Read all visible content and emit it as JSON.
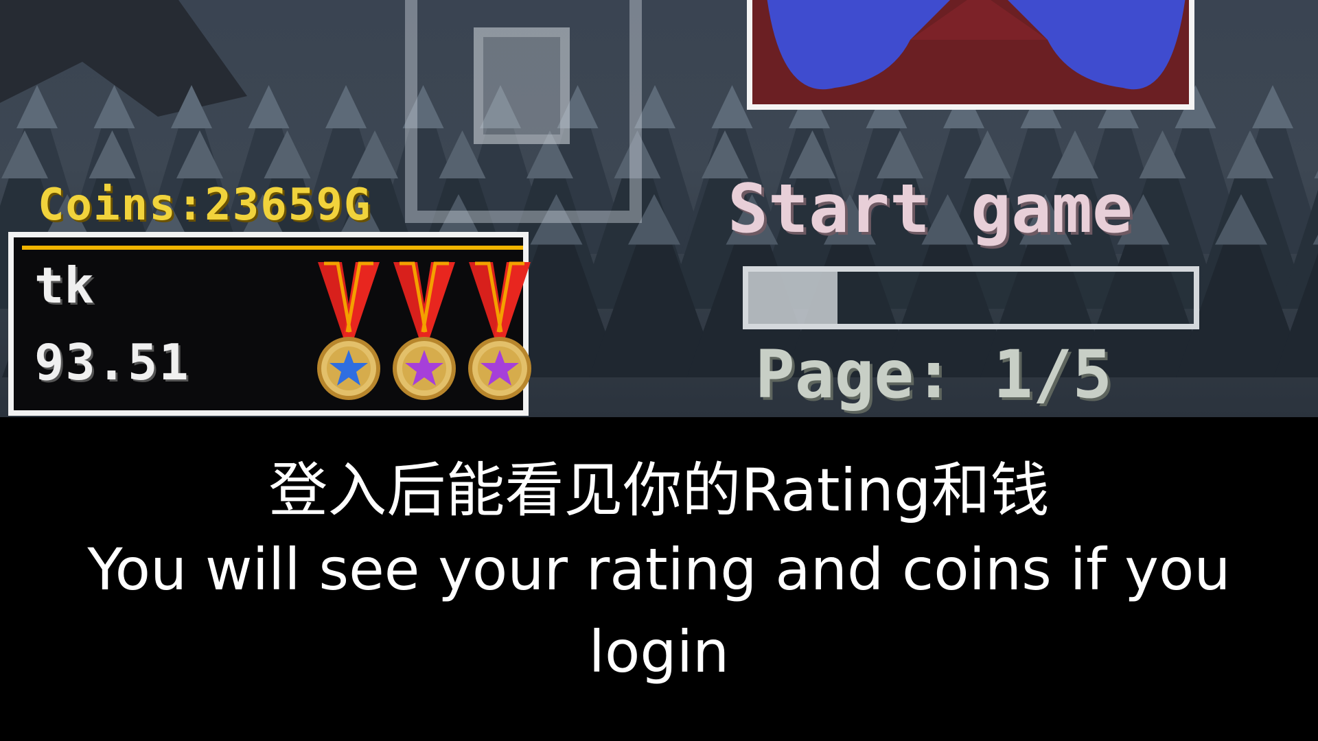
{
  "game": {
    "coins_label": "Coins:23659G",
    "player": {
      "name": "tk",
      "rating": "93.51",
      "medals": [
        {
          "star_color": "#2f6ee0",
          "name": "medal-blue-star-icon"
        },
        {
          "star_color": "#a63fd9",
          "name": "medal-purple-star-icon"
        },
        {
          "star_color": "#a63fd9",
          "name": "medal-purple-star-icon"
        }
      ]
    },
    "start_label": "Start game",
    "page_label": "Page: 1/5",
    "progress_fraction": 0.2
  },
  "subtitles": {
    "zh": "登入后能看见你的Rating和钱",
    "en": "You will see your rating and coins if you login"
  },
  "colors": {
    "coins": "#f1d33c",
    "card_accent": "#f1b400",
    "preview_bg": "#6b1f23",
    "preview_blue": "#3f4ccf"
  }
}
